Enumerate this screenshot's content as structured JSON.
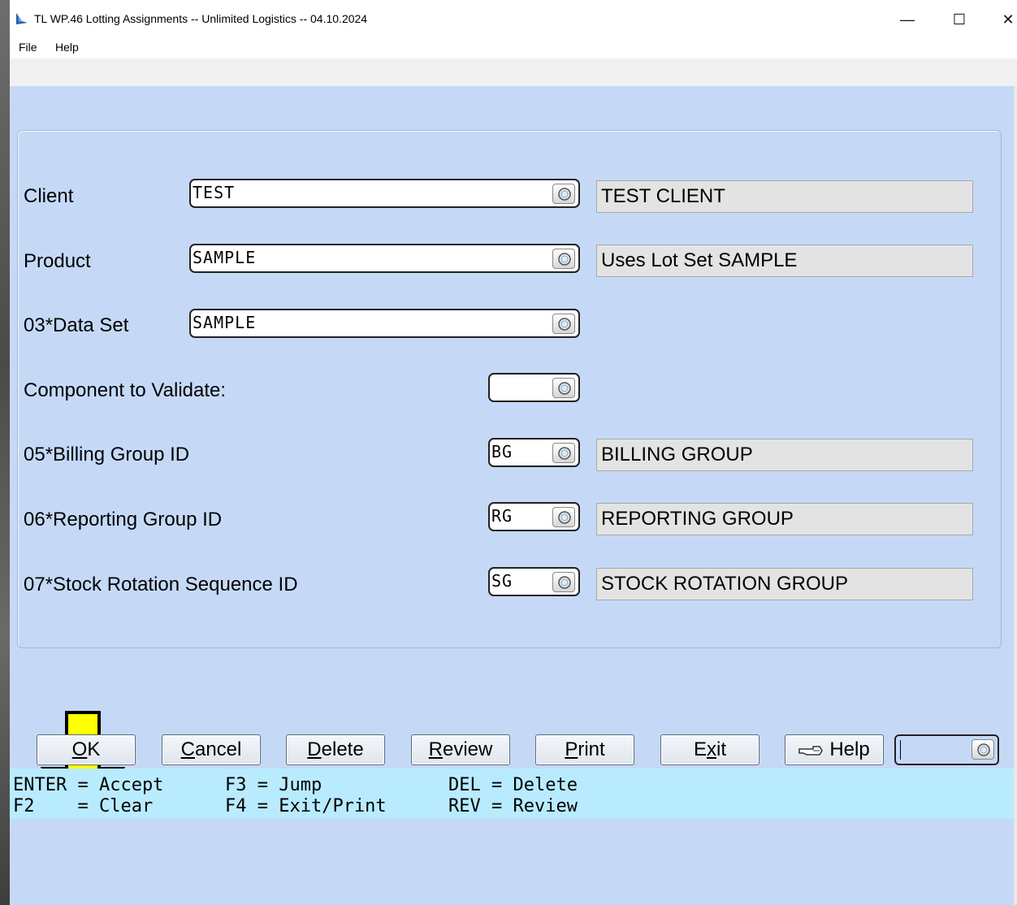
{
  "window": {
    "title": "TL WP.46 Lotting Assignments -- Unlimited Logistics -- 04.10.2024",
    "controls": {
      "minimize": "—",
      "maximize": "☐",
      "close": "✕"
    }
  },
  "menu": {
    "items": [
      "File",
      "Help"
    ]
  },
  "form": {
    "client": {
      "label": "Client",
      "value": "TEST",
      "description": "TEST CLIENT"
    },
    "product": {
      "label": "Product",
      "value": "SAMPLE",
      "description": "Uses Lot Set SAMPLE"
    },
    "data_set": {
      "label": "03*Data Set",
      "value": "SAMPLE"
    },
    "component": {
      "label": "Component to Validate:",
      "value": ""
    },
    "billing_group": {
      "label": "05*Billing Group ID",
      "value": "BG",
      "description": "BILLING GROUP"
    },
    "reporting_group": {
      "label": "06*Reporting Group ID",
      "value": "RG",
      "description": "REPORTING GROUP"
    },
    "stock_rotation": {
      "label": "07*Stock Rotation Sequence ID",
      "value": "SG",
      "description": "STOCK ROTATION GROUP"
    }
  },
  "buttons": {
    "ok": {
      "hotkey": "O",
      "rest": "K"
    },
    "cancel": {
      "hotkey": "C",
      "rest": "ancel"
    },
    "delete": {
      "hotkey": "D",
      "rest": "elete"
    },
    "review": {
      "hotkey": "R",
      "rest": "eview"
    },
    "print": {
      "hotkey": "P",
      "rest": "rint"
    },
    "exit": {
      "pre": "E",
      "hotkey": "x",
      "rest": "it"
    },
    "help": {
      "label": "Help"
    }
  },
  "keybar": {
    "row1": [
      "ENTER = Accept",
      "F3 = Jump",
      "DEL = Delete"
    ],
    "row2": [
      "F2    = Clear",
      "F4 = Exit/Print",
      "REV = Review"
    ]
  },
  "colors": {
    "client_bg": "#c5d9f7",
    "keybar_bg": "#b9ebff",
    "arrow": "#ffff00"
  }
}
